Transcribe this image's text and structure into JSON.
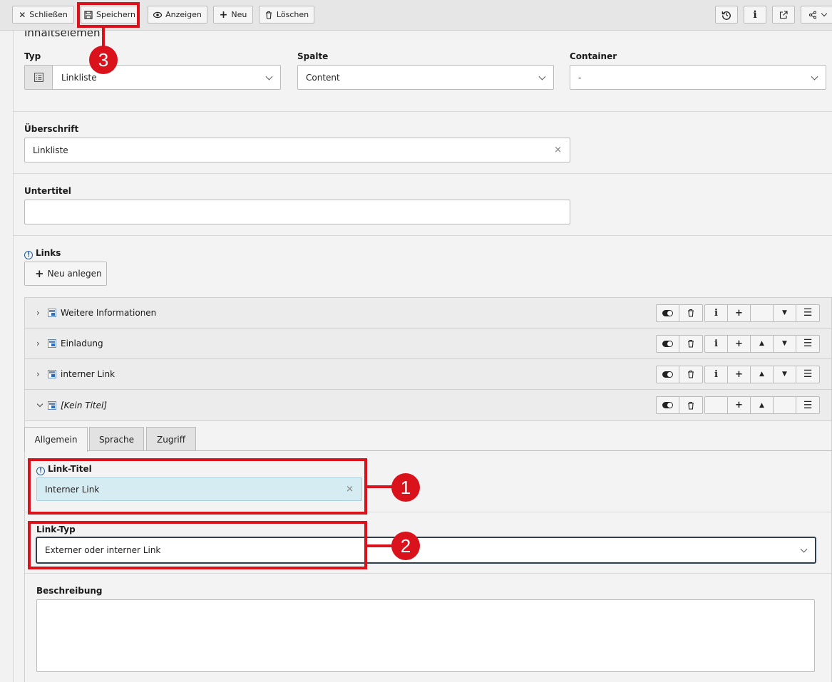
{
  "toolbar": {
    "close_label": "Schließen",
    "save_label": "Speichern",
    "view_label": "Anzeigen",
    "new_label": "Neu",
    "delete_label": "Löschen"
  },
  "section_title": "Inhaltselemen",
  "fields": {
    "typ": {
      "label": "Typ",
      "value": "Linkliste"
    },
    "spalte": {
      "label": "Spalte",
      "value": "Content"
    },
    "container": {
      "label": "Container",
      "value": "-"
    },
    "ueberschrift": {
      "label": "Überschrift",
      "value": "Linkliste"
    },
    "untertitel": {
      "label": "Untertitel",
      "value": ""
    }
  },
  "links": {
    "label": "Links",
    "new_button": "Neu anlegen",
    "items": [
      {
        "title": "Weitere Informationen",
        "expanded": false
      },
      {
        "title": "Einladung",
        "expanded": false
      },
      {
        "title": "interner Link",
        "expanded": false
      },
      {
        "title": "[Kein Titel]",
        "expanded": true
      }
    ]
  },
  "tabs": [
    "Allgemein",
    "Sprache",
    "Zugriff"
  ],
  "link_form": {
    "link_titel": {
      "label": "Link-Titel",
      "value": "Interner Link"
    },
    "link_typ": {
      "label": "Link-Typ",
      "value": "Externer oder interner Link"
    },
    "beschreibung": {
      "label": "Beschreibung",
      "value": ""
    }
  },
  "annotations": [
    "1",
    "2",
    "3"
  ],
  "colors": {
    "annotation_red": "#d9121b",
    "highlight_field": "#d5ecf3",
    "focus_border": "#2f3f52"
  }
}
